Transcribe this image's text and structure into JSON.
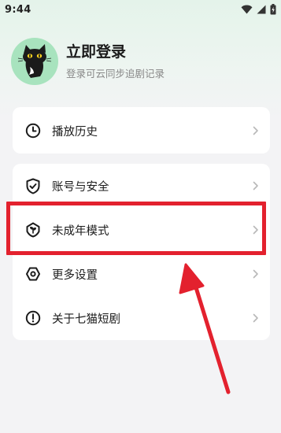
{
  "status_bar": {
    "time": "9:44",
    "icons": [
      "wifi-icon",
      "signal-icon",
      "battery-icon"
    ]
  },
  "profile": {
    "title": "立即登录",
    "subtitle": "登录可云同步追剧记录",
    "avatar_icon": "black-cat-avatar"
  },
  "menu": {
    "history": {
      "label": "播放历史",
      "icon": "clock-icon"
    },
    "items": [
      {
        "label": "账号与安全",
        "icon": "shield-check-icon"
      },
      {
        "label": "未成年模式",
        "icon": "teen-mode-shield-icon"
      },
      {
        "label": "更多设置",
        "icon": "settings-hexagon-icon"
      },
      {
        "label": "关于七猫短剧",
        "icon": "info-circle-icon"
      }
    ]
  },
  "annotation": {
    "highlight_color": "#e3212e",
    "highlighted_item": "未成年模式"
  },
  "colors": {
    "header_gradient": "#e4f3ea",
    "avatar_bg": "#a8e3be",
    "background": "#f3f3f5",
    "card": "#ffffff",
    "annotation": "#e3212e"
  }
}
